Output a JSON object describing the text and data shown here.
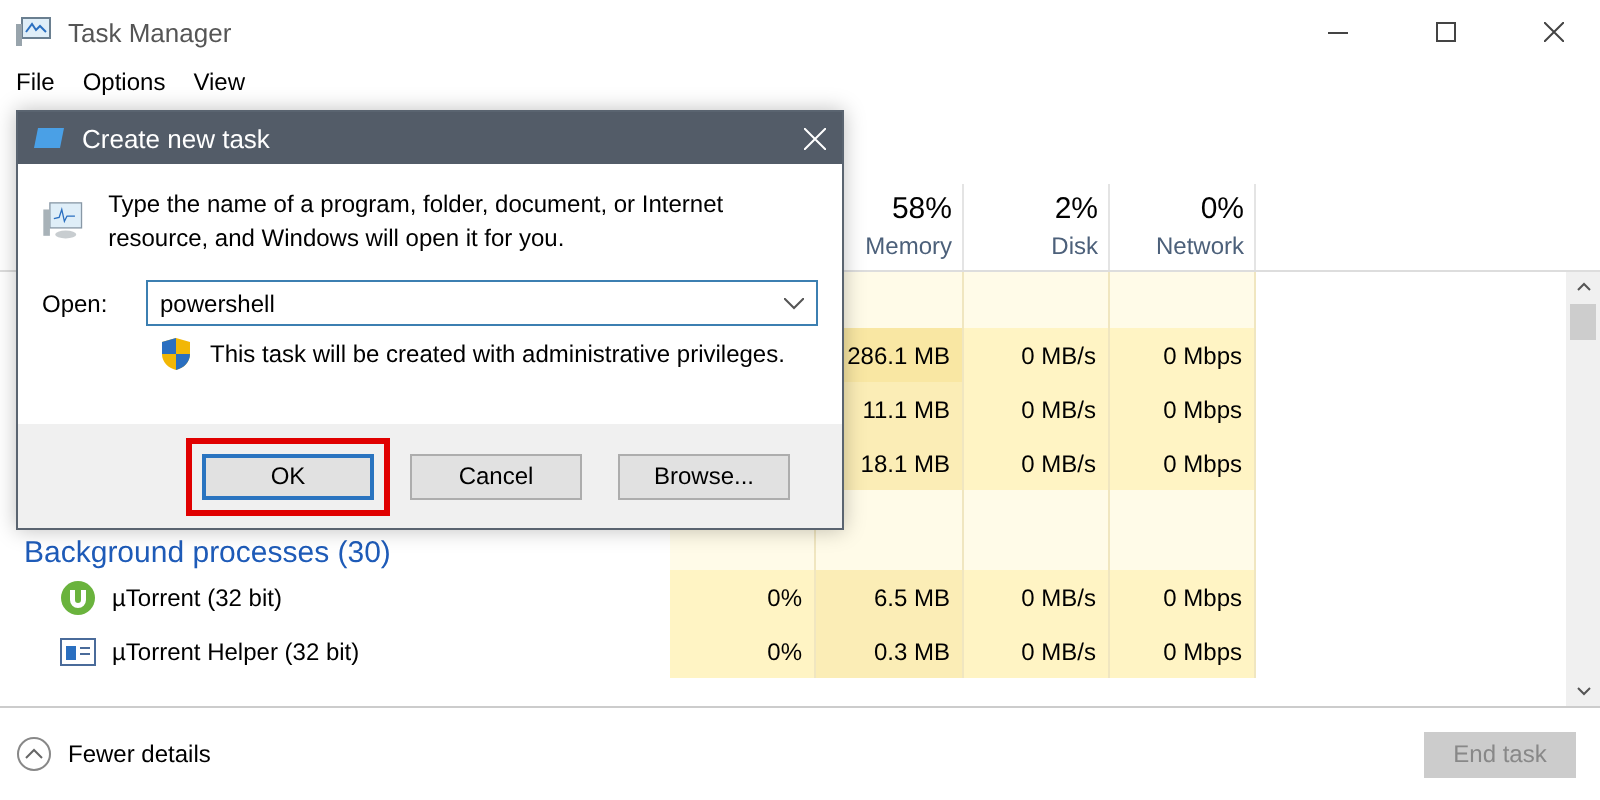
{
  "window": {
    "title": "Task Manager"
  },
  "menu": [
    "File",
    "Options",
    "View"
  ],
  "columns": [
    {
      "percent": "58%",
      "label": "Memory"
    },
    {
      "percent": "2%",
      "label": "Disk"
    },
    {
      "percent": "0%",
      "label": "Network"
    }
  ],
  "rows": [
    {
      "kind": "blank"
    },
    {
      "kind": "process",
      "cells": [
        {
          "text": "286.1 MB",
          "color": "#f9e7a3"
        },
        {
          "text": "0 MB/s",
          "color": "#fff4c4"
        },
        {
          "text": "0 Mbps",
          "color": "#fff4c4"
        }
      ]
    },
    {
      "kind": "process",
      "cells": [
        {
          "text": "11.1 MB",
          "color": "#fbedb6"
        },
        {
          "text": "0 MB/s",
          "color": "#fff4c4"
        },
        {
          "text": "0 Mbps",
          "color": "#fff4c4"
        }
      ]
    },
    {
      "kind": "process",
      "cells": [
        {
          "text": "18.1 MB",
          "color": "#fbedb6"
        },
        {
          "text": "0 MB/s",
          "color": "#fff4c4"
        },
        {
          "text": "0 Mbps",
          "color": "#fff4c4"
        }
      ]
    },
    {
      "kind": "group",
      "name": "Background processes (30)"
    },
    {
      "kind": "torrent_app",
      "name": "µTorrent (32 bit)",
      "cpu": "0%",
      "cells": [
        {
          "text": "6.5 MB",
          "color": "#fbedb6"
        },
        {
          "text": "0 MB/s",
          "color": "#fff4c4"
        },
        {
          "text": "0 Mbps",
          "color": "#fff4c4"
        }
      ]
    },
    {
      "kind": "helper_app",
      "name": "µTorrent Helper (32 bit)",
      "cpu": "0%",
      "cells": [
        {
          "text": "0.3 MB",
          "color": "#fbedb6"
        },
        {
          "text": "0 MB/s",
          "color": "#fff4c4"
        },
        {
          "text": "0 Mbps",
          "color": "#fff4c4"
        }
      ]
    }
  ],
  "footer": {
    "details": "Fewer details",
    "end_task": {
      "label": "End task",
      "disabled": true
    }
  },
  "dialog": {
    "title": "Create new task",
    "message": "Type the name of a program, folder, document, or Internet resource, and Windows will open it for you.",
    "open_label": "Open:",
    "value": "powershell",
    "note": "This task will be created with administrative privileges.",
    "buttons": [
      {
        "label": "OK",
        "highlighted": true
      },
      {
        "label": "Cancel",
        "highlighted": false
      },
      {
        "label": "Browse...",
        "highlighted": false
      }
    ]
  }
}
